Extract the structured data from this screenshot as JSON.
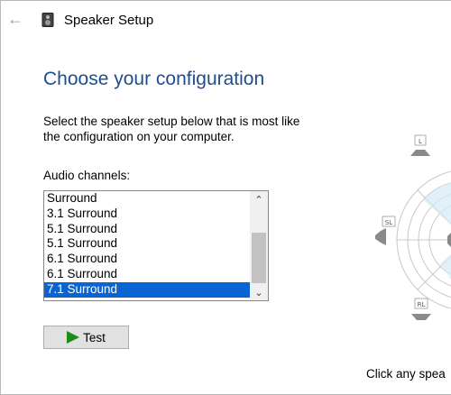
{
  "window": {
    "title": "Speaker Setup",
    "back_icon": "back-arrow-icon",
    "app_icon": "speaker-icon"
  },
  "page": {
    "heading": "Choose your configuration",
    "instructions_line1": "Select the speaker setup below that is most like",
    "instructions_line2": "the configuration on your computer."
  },
  "channels": {
    "label": "Audio channels:",
    "items": [
      "Surround",
      "3.1 Surround",
      "5.1 Surround",
      "5.1 Surround",
      "6.1 Surround",
      "6.1 Surround",
      "7.1 Surround"
    ],
    "selected_index": 6
  },
  "test_button": {
    "label": "Test",
    "icon": "play-icon"
  },
  "diagram": {
    "labels": [
      "L",
      "SL",
      "RL"
    ]
  },
  "hint": "Click any spea",
  "colors": {
    "heading": "#1e4e8c",
    "selection": "#0a64d2",
    "play": "#1c8c1c"
  }
}
